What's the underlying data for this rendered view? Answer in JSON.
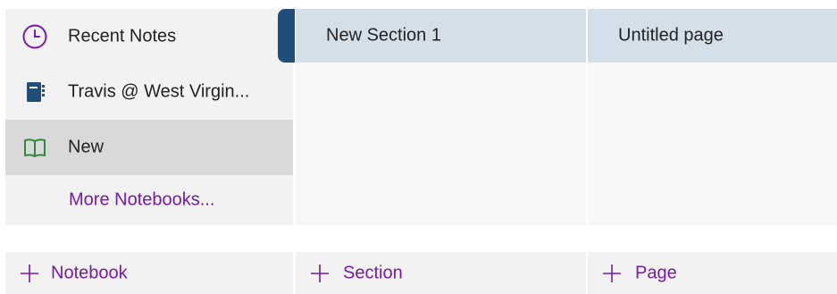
{
  "notebooks": {
    "recent": {
      "label": "Recent Notes",
      "icon": "clock-icon"
    },
    "items": [
      {
        "label": "Travis @ West Virgin...",
        "icon": "notebook-icon",
        "color": "#1e4e79"
      },
      {
        "label": "New",
        "icon": "open-book-icon",
        "color": "#2e8b3d",
        "selected": true
      }
    ],
    "more_label": "More Notebooks..."
  },
  "sections": {
    "items": [
      {
        "label": "New Section 1",
        "selected": true,
        "color": "#1e4e79"
      }
    ]
  },
  "pages": {
    "items": [
      {
        "label": "Untitled page",
        "selected": true
      }
    ]
  },
  "bottom_bar": {
    "add_notebook_label": "Notebook",
    "add_section_label": "Section",
    "add_page_label": "Page"
  },
  "colors": {
    "accent": "#7719aa",
    "selected_section_bg": "#d3e0ea",
    "selected_notebook_bg": "#d9d9d9"
  }
}
